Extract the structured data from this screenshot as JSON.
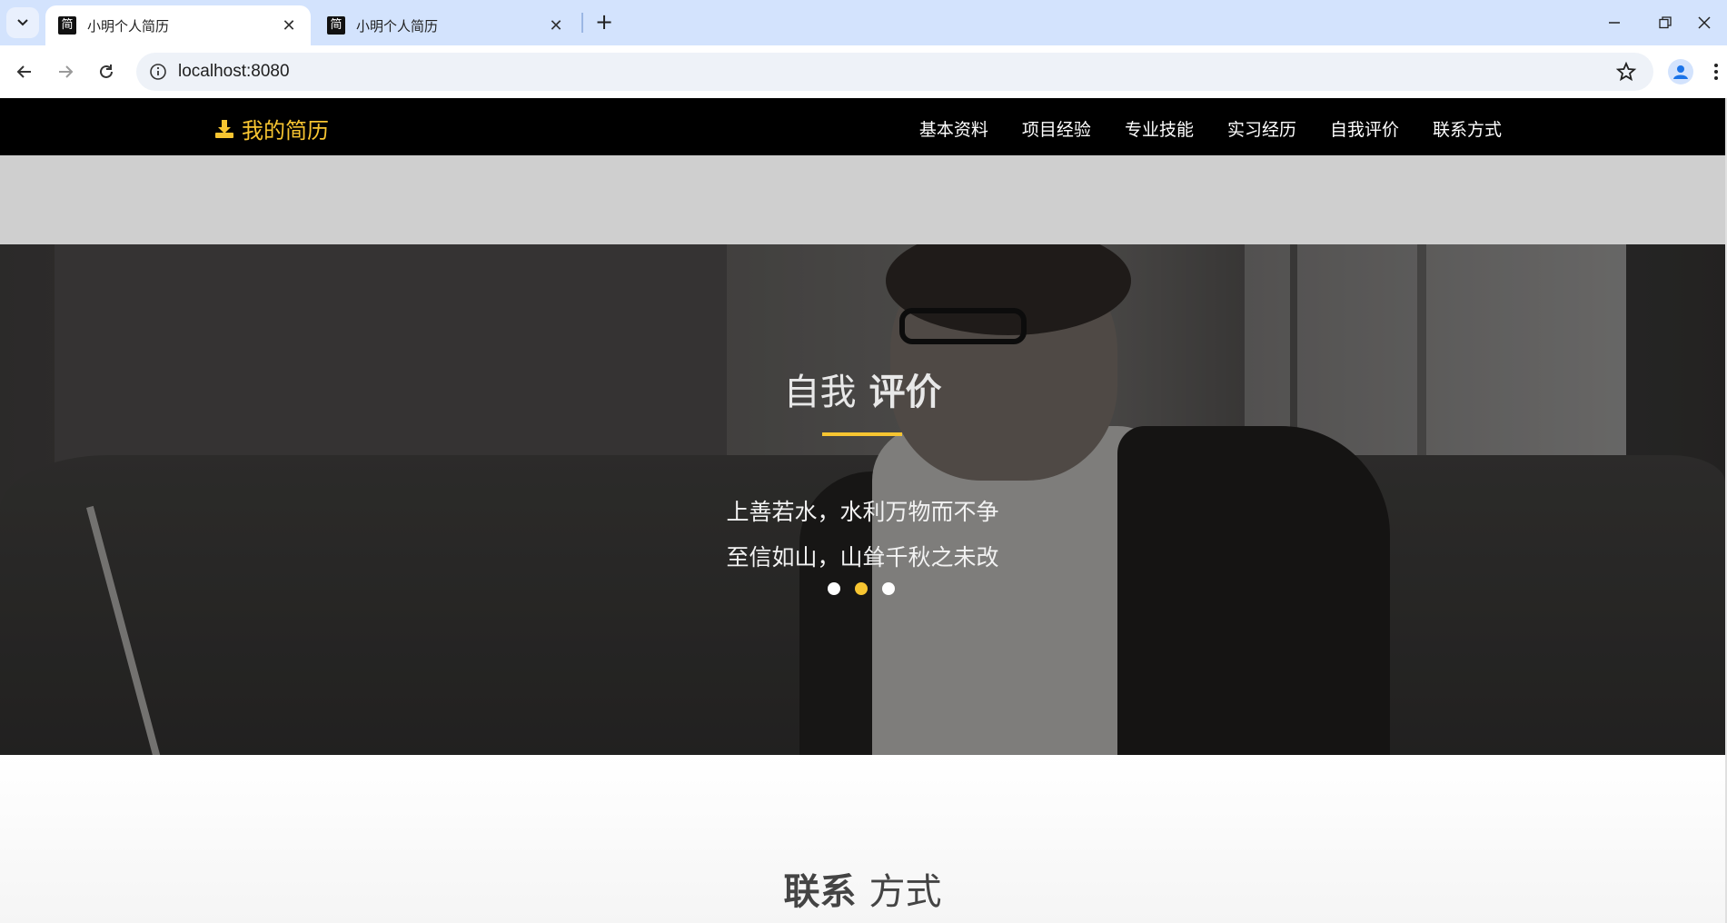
{
  "browser": {
    "tabs": [
      {
        "title": "小明个人简历",
        "favicon": "简"
      },
      {
        "title": "小明个人简历",
        "favicon": "简"
      }
    ],
    "url": "localhost:8080"
  },
  "site": {
    "brand": "我的简历",
    "menu": [
      "基本资料",
      "项目经验",
      "专业技能",
      "实习经历",
      "自我评价",
      "联系方式"
    ]
  },
  "hero": {
    "title_light": "自我",
    "title_bold": "评价",
    "lines": [
      "上善若水，水利万物而不争",
      "至信如山，山耸千秋之未改"
    ],
    "active_slide": 2,
    "slide_count": 3
  },
  "contact": {
    "title_bold": "联系",
    "title_light": "方式"
  },
  "colors": {
    "accent": "#f7c531",
    "nav_bg": "#000000",
    "tabstrip_bg": "#d3e3fd"
  }
}
